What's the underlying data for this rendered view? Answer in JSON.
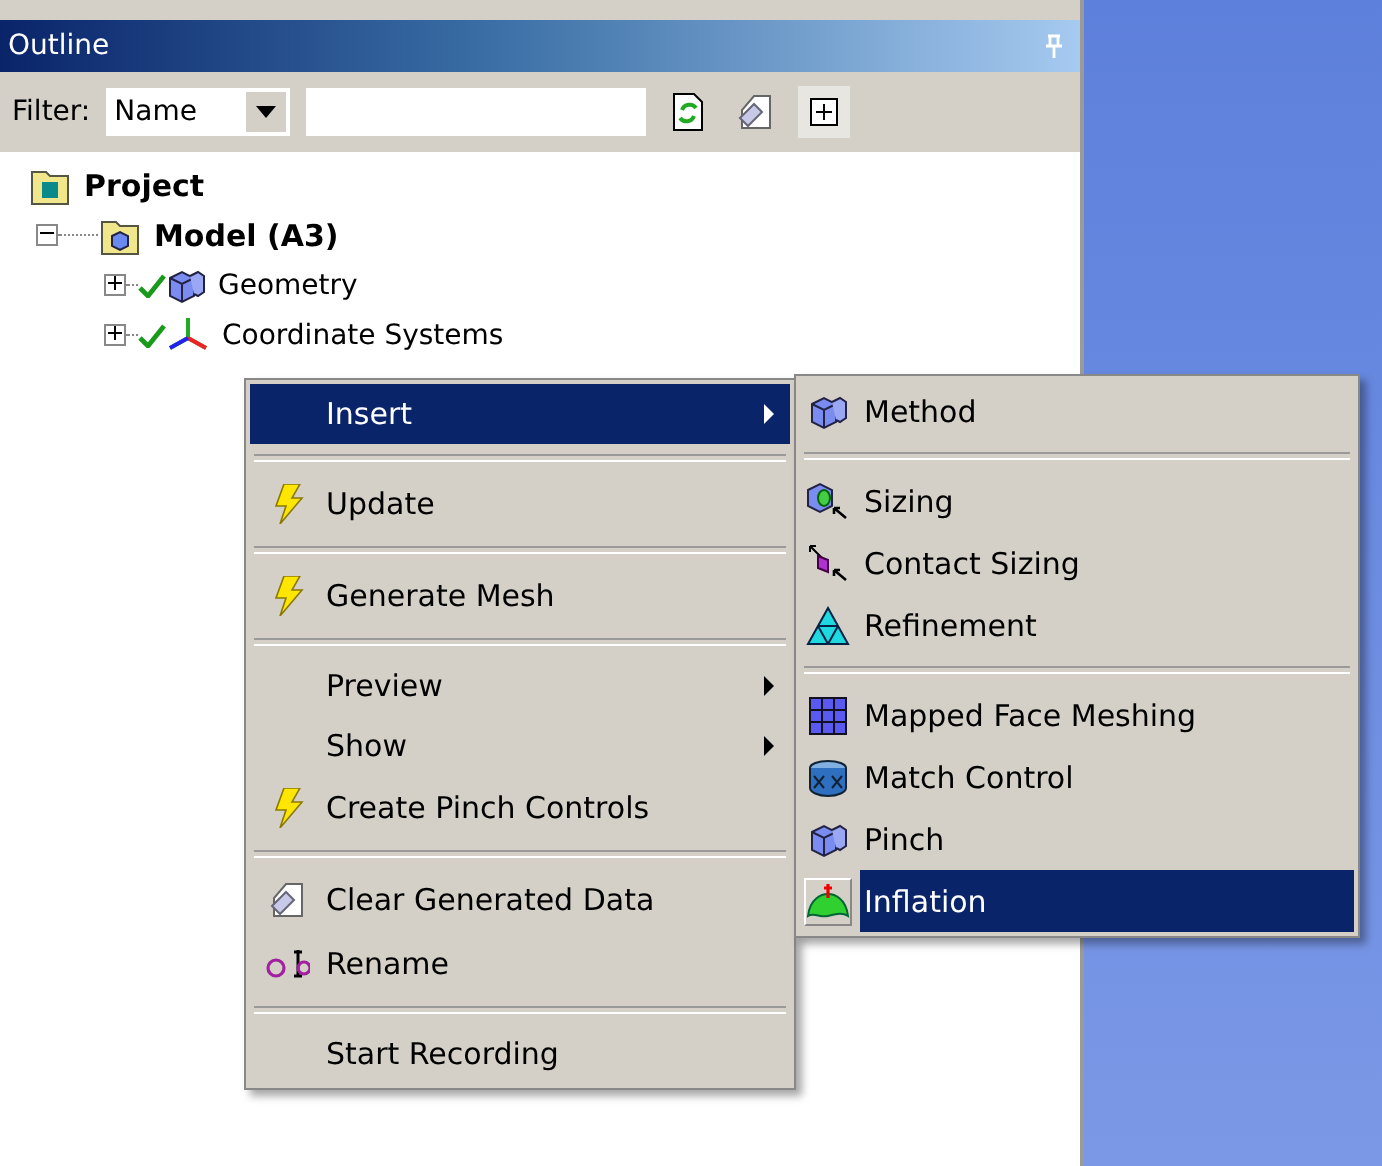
{
  "panel": {
    "title": "Outline"
  },
  "filter": {
    "label": "Filter:",
    "value": "Name"
  },
  "tree": [
    {
      "label": "Project",
      "children": [
        {
          "label": "Model (A3)",
          "expanded": true,
          "children": [
            {
              "label": "Geometry",
              "expanded": false,
              "valid": true
            },
            {
              "label": "Coordinate Systems",
              "expanded": false,
              "valid": true
            }
          ]
        }
      ]
    }
  ],
  "context_menu": [
    {
      "kind": "plain",
      "label": "Insert",
      "submenu": true,
      "selected": true
    },
    {
      "kind": "separator"
    },
    {
      "kind": "bolt",
      "label": "Update",
      "submenu": false,
      "selected": false
    },
    {
      "kind": "separator"
    },
    {
      "kind": "bolt",
      "label": "Generate Mesh",
      "submenu": false,
      "selected": false
    },
    {
      "kind": "separator"
    },
    {
      "kind": "plain",
      "label": "Preview",
      "submenu": true,
      "selected": false
    },
    {
      "kind": "plain",
      "label": "Show",
      "submenu": true,
      "selected": false
    },
    {
      "kind": "bolt",
      "label": "Create Pinch Controls",
      "submenu": false,
      "selected": false
    },
    {
      "kind": "separator"
    },
    {
      "kind": "eraser",
      "label": "Clear Generated Data",
      "submenu": false,
      "selected": false
    },
    {
      "kind": "rename",
      "label": "Rename",
      "submenu": false,
      "selected": false
    },
    {
      "kind": "separator"
    },
    {
      "kind": "plain",
      "label": "Start Recording",
      "submenu": false,
      "selected": false
    }
  ],
  "submenu": [
    {
      "kind": "cubes",
      "label": "Method",
      "selected": false
    },
    {
      "kind": "separator"
    },
    {
      "kind": "sizing",
      "label": "Sizing",
      "selected": false
    },
    {
      "kind": "contact",
      "label": "Contact Sizing",
      "selected": false
    },
    {
      "kind": "triangle",
      "label": "Refinement",
      "selected": false
    },
    {
      "kind": "separator"
    },
    {
      "kind": "grid",
      "label": "Mapped Face Meshing",
      "selected": false
    },
    {
      "kind": "match",
      "label": "Match Control",
      "selected": false
    },
    {
      "kind": "cubes",
      "label": "Pinch",
      "selected": false
    },
    {
      "kind": "dome",
      "label": "Inflation",
      "selected": true
    }
  ]
}
